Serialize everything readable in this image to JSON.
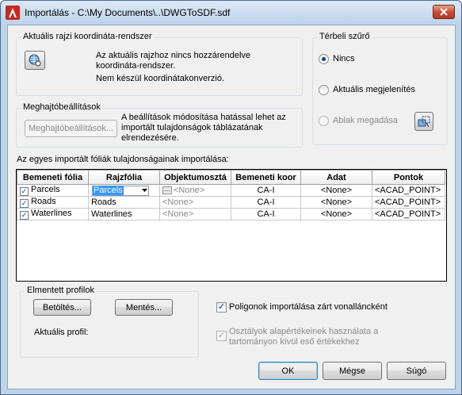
{
  "window": {
    "title": "Importálás - C:\\My Documents\\..\\DWGToSDF.sdf"
  },
  "coord": {
    "legend": "Aktuális rajzi koordináta-rendszer",
    "line1": "Az aktuális rajzhoz nincs hozzárendelve",
    "line2": "koordináta-rendszer.",
    "line3": "Nem készül koordinátakonverzió."
  },
  "driver": {
    "legend": "Meghajtóbeállítások",
    "button": "Meghajtóbeállítások...",
    "line1": "A beállítások módosítása hatással lehet az",
    "line2": "importált tulajdonságok táblázatának",
    "line3": "elrendezésére."
  },
  "filter": {
    "legend": "Térbeli szűrő",
    "opt1": "Nincs",
    "opt2": "Aktuális megjelenítés",
    "opt3": "Ablak megadása"
  },
  "grid": {
    "label": "Az egyes importált fóliák tulajdonságainak importálása:",
    "headers": [
      "Bemeneti fólia",
      "Rajzfólia",
      "Objektumosztá",
      "Bemeneti koor",
      "Adat",
      "Pontok"
    ],
    "rows": [
      {
        "input": "Parcels",
        "layer": "Parcels",
        "class": "<None>",
        "coord": "CA-I",
        "data": "<None>",
        "points": "<ACAD_POINT>"
      },
      {
        "input": "Roads",
        "layer": "Roads",
        "class": "<None>",
        "coord": "CA-I",
        "data": "<None>",
        "points": "<ACAD_POINT>"
      },
      {
        "input": "Waterlines",
        "layer": "Waterlines",
        "class": "<None>",
        "coord": "CA-I",
        "data": "<None>",
        "points": "<ACAD_POINT>"
      }
    ]
  },
  "profiles": {
    "legend": "Elmentett profilok",
    "load": "Betöltés...",
    "save": "Mentés...",
    "current": "Aktuális profil:"
  },
  "options": {
    "polygons": "Poligonok importálása zárt vonalláncként",
    "classes_line1": "Osztályok alapértékeinek használata a",
    "classes_line2": "tartományon kívül eső értékekhez"
  },
  "buttons": {
    "ok": "OK",
    "cancel": "Mégse",
    "help": "Súgó"
  },
  "colors": {
    "accent": "#3399ff",
    "titlebar": "#bcd3ea",
    "close": "#c74a31"
  }
}
